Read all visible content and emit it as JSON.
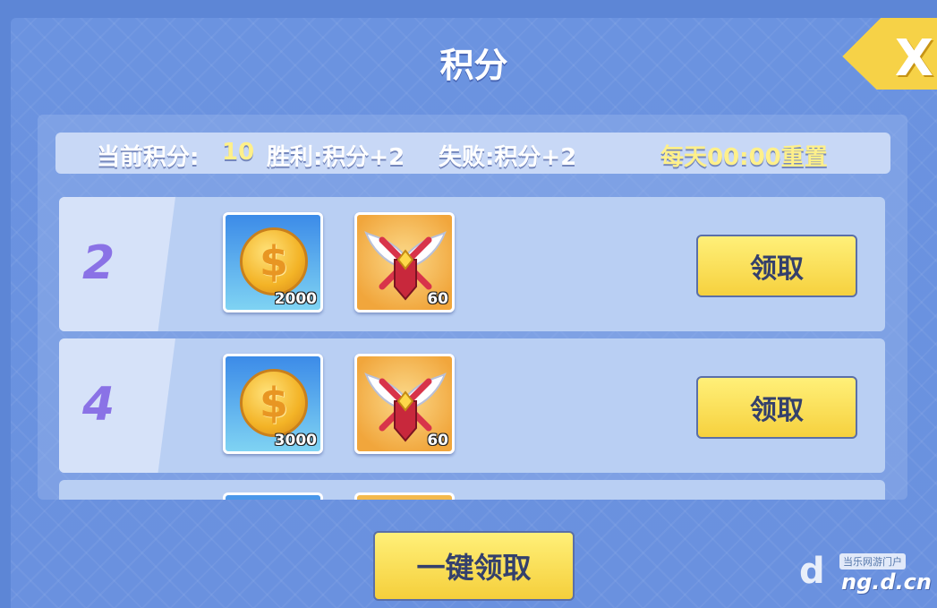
{
  "window": {
    "title": "积分"
  },
  "info_bar": {
    "current_points_label": "当前积分:",
    "current_points_value": "10",
    "win_rule": "胜利:积分+2",
    "loss_rule": "失败:积分+2",
    "reset_note": "每天00:00重置"
  },
  "rewards": [
    {
      "tier": "2",
      "items": [
        {
          "icon": "gold-coin-icon",
          "quantity": "2000"
        },
        {
          "icon": "winged-emblem-icon",
          "quantity": "60"
        }
      ],
      "claim_label": "领取"
    },
    {
      "tier": "4",
      "items": [
        {
          "icon": "gold-coin-icon",
          "quantity": "3000"
        },
        {
          "icon": "winged-emblem-icon",
          "quantity": "60"
        }
      ],
      "claim_label": "领取"
    }
  ],
  "footer": {
    "claim_all_label": "一键领取"
  },
  "close": {
    "icon": "close-icon",
    "glyph": "X"
  },
  "watermark": {
    "tag": "当乐网游门户",
    "url": "ng.d.cn"
  },
  "colors": {
    "panel_blue": "#6b93e0",
    "button_yellow": "#f6d13e",
    "tier_purple": "#8a72e6",
    "highlight_yellow": "#fff08a"
  }
}
